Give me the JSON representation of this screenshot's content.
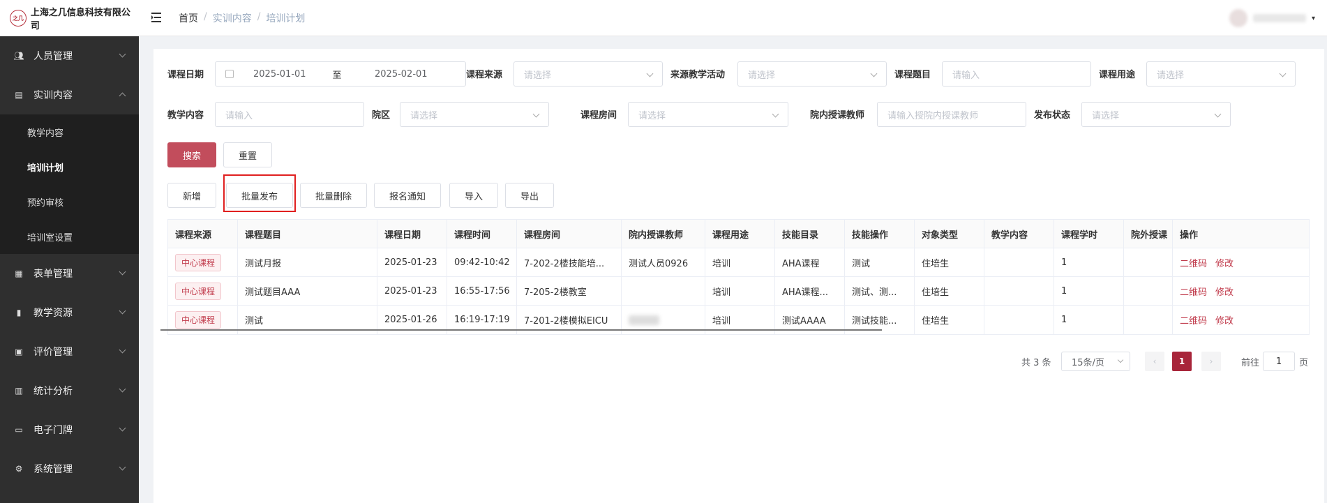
{
  "header": {
    "company": "上海之几信息科技有限公司",
    "logo_mark": "之几",
    "breadcrumb": [
      "首页",
      "实训内容",
      "培训计划"
    ]
  },
  "sidebar": {
    "items": [
      {
        "label": "人员管理",
        "icon": "user-icon"
      },
      {
        "label": "实训内容",
        "icon": "book-icon",
        "expanded": true,
        "children": [
          "教学内容",
          "培训计划",
          "预约审核",
          "培训室设置"
        ],
        "active_child": "培训计划"
      },
      {
        "label": "表单管理",
        "icon": "form-icon"
      },
      {
        "label": "教学资源",
        "icon": "resource-icon"
      },
      {
        "label": "评价管理",
        "icon": "evaluation-icon"
      },
      {
        "label": "统计分析",
        "icon": "bar-chart-icon"
      },
      {
        "label": "电子门牌",
        "icon": "monitor-icon"
      },
      {
        "label": "系统管理",
        "icon": "gear-icon"
      }
    ]
  },
  "filters": {
    "course_date": {
      "label": "课程日期",
      "start": "2025-01-01",
      "to": "至",
      "end": "2025-02-01"
    },
    "course_source": {
      "label": "课程来源",
      "placeholder": "请选择"
    },
    "source_activity": {
      "label": "来源教学活动",
      "placeholder": "请选择"
    },
    "course_title": {
      "label": "课程题目",
      "placeholder": "请输入"
    },
    "course_use": {
      "label": "课程用途",
      "placeholder": "请选择"
    },
    "teaching_content": {
      "label": "教学内容",
      "placeholder": "请输入"
    },
    "campus": {
      "label": "院区",
      "placeholder": "请选择"
    },
    "course_room": {
      "label": "课程房间",
      "placeholder": "请选择"
    },
    "internal_teacher": {
      "label": "院内授课教师",
      "placeholder": "请输入授院内授课教师"
    },
    "publish_status": {
      "label": "发布状态",
      "placeholder": "请选择"
    }
  },
  "buttons": {
    "search": "搜索",
    "reset": "重置",
    "add": "新增",
    "batch_publish": "批量发布",
    "batch_delete": "批量删除",
    "signup_notice": "报名通知",
    "import": "导入",
    "export": "导出"
  },
  "table": {
    "headers": [
      "课程来源",
      "课程题目",
      "课程日期",
      "课程时间",
      "课程房间",
      "院内授课教师",
      "课程用途",
      "技能目录",
      "技能操作",
      "对象类型",
      "教学内容",
      "课程学时",
      "院外授课",
      "操作"
    ],
    "rows": [
      {
        "source": "中心课程",
        "title": "测试月报",
        "date": "2025-01-23",
        "time": "09:42-10:42",
        "room": "7-202-2楼技能培...",
        "teacher": "测试人员0926",
        "use": "培训",
        "catalog": "AHA课程",
        "operation": "测试",
        "target": "住培生",
        "content": "",
        "hours": "1",
        "external": ""
      },
      {
        "source": "中心课程",
        "title": "测试题目AAA",
        "date": "2025-01-23",
        "time": "16:55-17:56",
        "room": "7-205-2楼教室",
        "teacher": "",
        "use": "培训",
        "catalog": "AHA课程...",
        "operation": "测试、测...",
        "target": "住培生",
        "content": "",
        "hours": "1",
        "external": ""
      },
      {
        "source": "中心课程",
        "title": "测试",
        "date": "2025-01-26",
        "time": "16:19-17:19",
        "room": "7-201-2楼模拟EICU",
        "teacher": "",
        "use": "培训",
        "catalog": "测试AAAA",
        "operation": "测试技能...",
        "target": "住培生",
        "content": "",
        "hours": "1",
        "external": ""
      }
    ],
    "actions": {
      "qrcode": "二维码",
      "edit": "修改"
    }
  },
  "pagination": {
    "total": "共 3 条",
    "page_size": "15条/页",
    "current": "1",
    "goto_prefix": "前往",
    "goto_value": "1",
    "goto_suffix": "页"
  },
  "colors": {
    "primary": "#c24d5c",
    "sidebar_bg": "#2f2f2f",
    "highlight": "#e02020"
  }
}
